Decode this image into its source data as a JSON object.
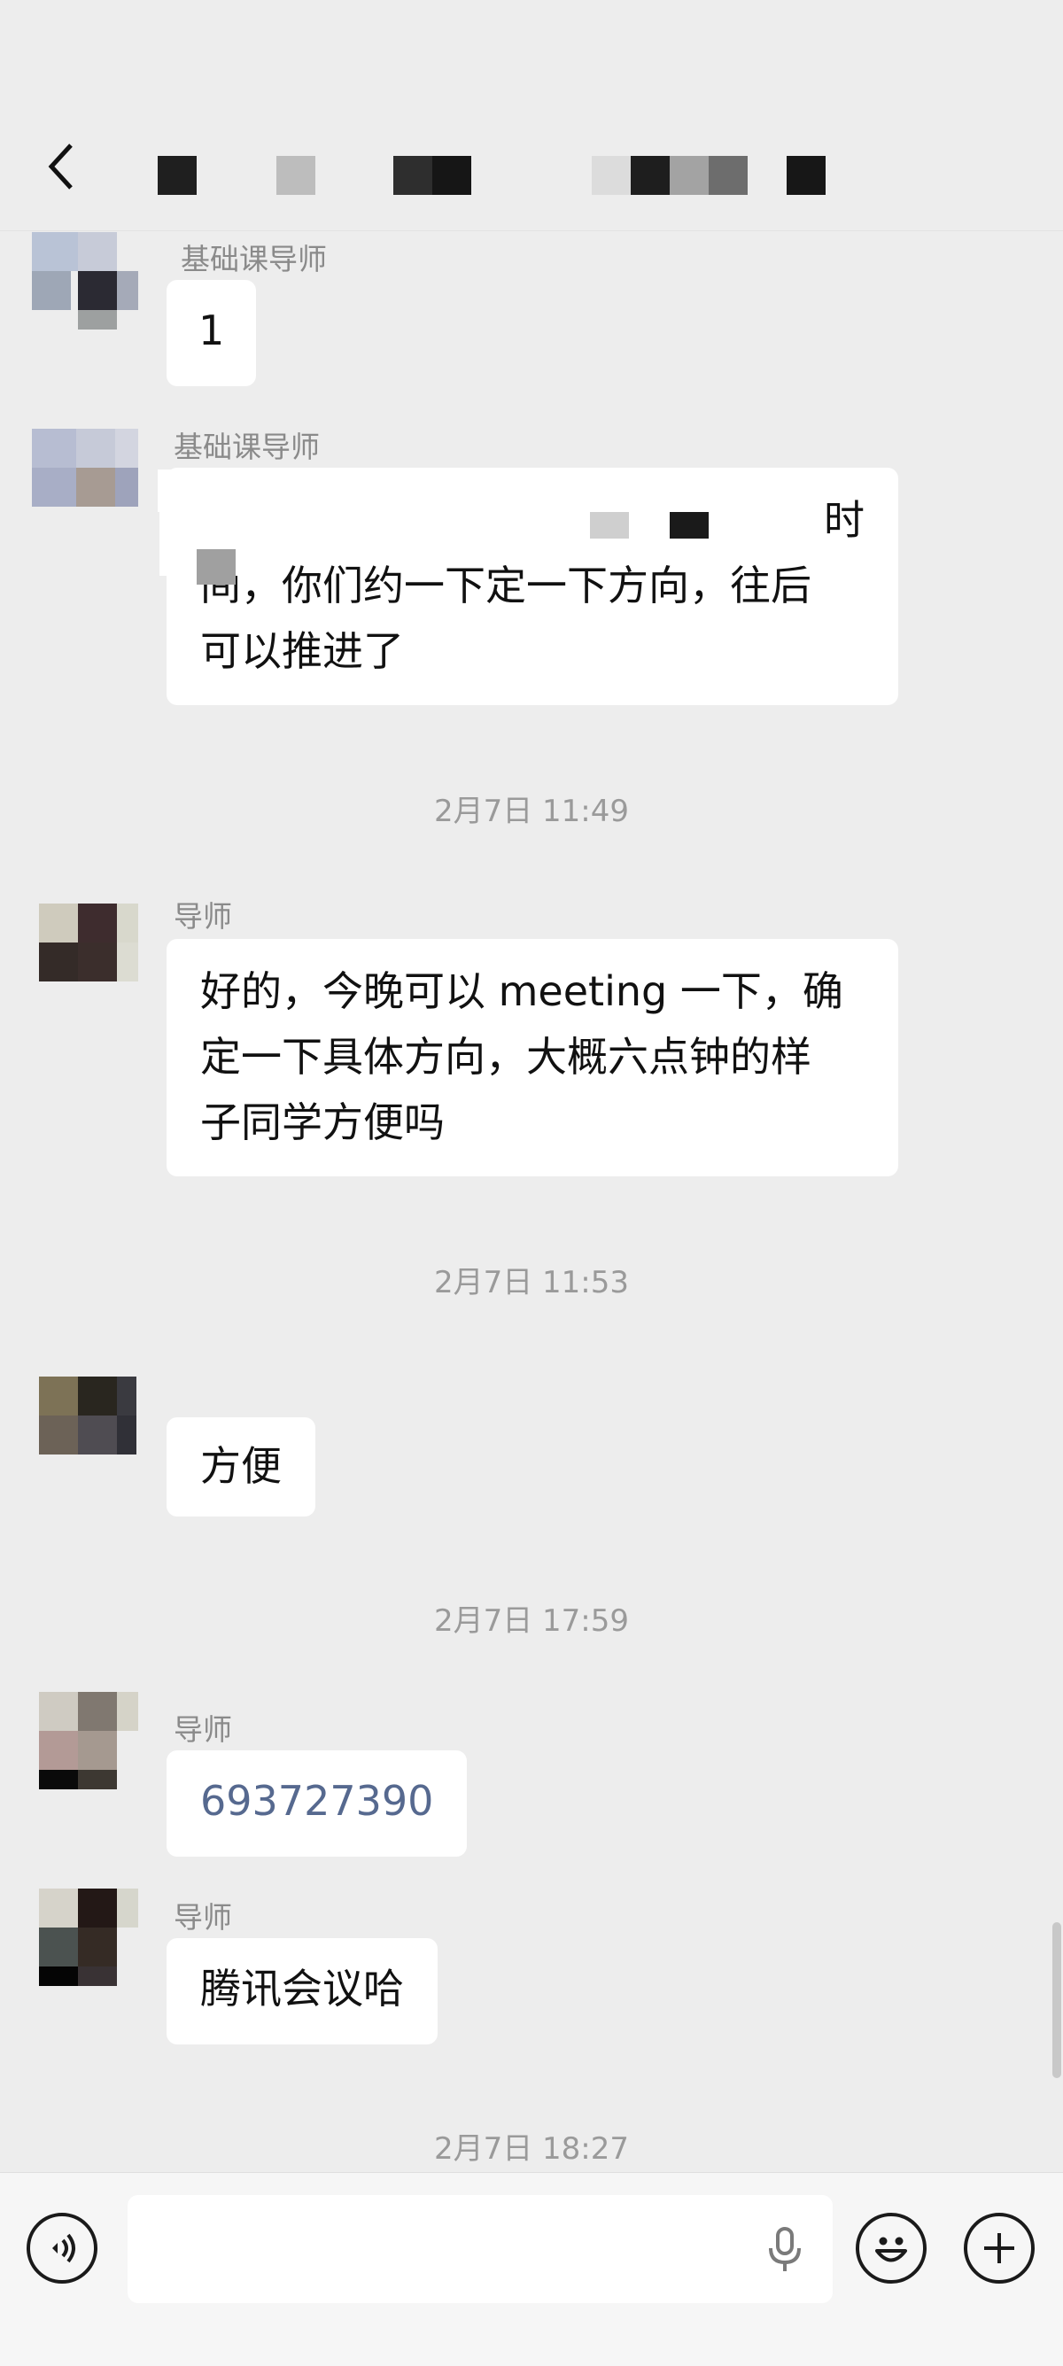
{
  "header": {
    "title": ""
  },
  "messages": [
    {
      "sender": "基础课导师",
      "text": "1"
    },
    {
      "sender": "基础课导师",
      "lines": [
        "时",
        "间，你们约一下定一下方向，往后",
        "可以推进了"
      ]
    },
    {
      "timestamp": "2月7日 11:49"
    },
    {
      "sender": "导师",
      "lines": [
        "好的，今晚可以 meeting 一下，确",
        "定一下具体方向，大概六点钟的样",
        "子同学方便吗"
      ]
    },
    {
      "timestamp": "2月7日 11:53"
    },
    {
      "sender": "",
      "text": "方便"
    },
    {
      "timestamp": "2月7日 17:59"
    },
    {
      "sender": "导师",
      "text": "693727390"
    },
    {
      "sender": "导师",
      "text": "腾讯会议哈"
    },
    {
      "timestamp": "2月7日 18:27"
    }
  ],
  "input": {
    "placeholder": ""
  },
  "icons": {
    "back": "chevron-left-icon",
    "voice": "voice-icon",
    "mic": "microphone-icon",
    "emoji": "emoji-icon",
    "more": "plus-icon"
  },
  "colors": {
    "background": "#ededed",
    "bubble": "#ffffff",
    "link": "#56698f"
  }
}
